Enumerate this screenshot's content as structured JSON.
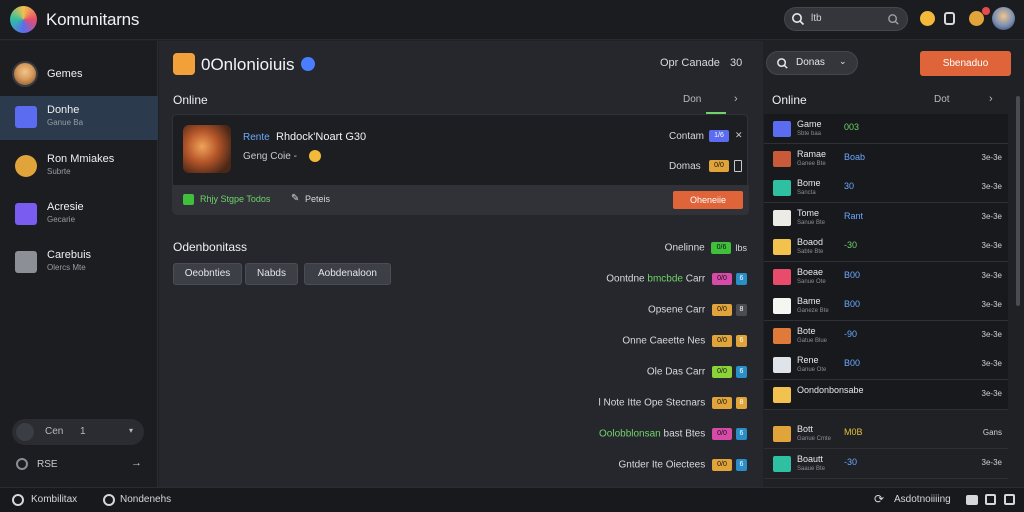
{
  "app": {
    "title": "Komunitarns",
    "search_value": "ltb"
  },
  "sidebar": {
    "profile": {
      "label": "Gemes"
    },
    "items": [
      {
        "label": "Donhe",
        "sub": "Ganue Ba",
        "color": "#5b6cf0",
        "icon": "check-icon"
      },
      {
        "label": "Ron Mmiakes",
        "sub": "Subrte",
        "color": "#e0a43a",
        "icon": "gear-icon"
      },
      {
        "label": "Acresie",
        "sub": "Gecarie",
        "color": "#7a5cf0",
        "icon": "folder-icon"
      },
      {
        "label": "Carebuis",
        "sub": "Olercs Mte",
        "color": "#8d8f96",
        "icon": "store-icon"
      }
    ],
    "status_pill": {
      "label": "Cen",
      "value": "1"
    },
    "footer": {
      "label": "RSE"
    }
  },
  "main": {
    "title": "0Onlonioiuis",
    "sort_label": "Opr Canade",
    "sort_value": "30",
    "dropdown_label": "Donas",
    "primary_button": "Sbenaduo",
    "online": {
      "label": "Online",
      "more": "Don"
    },
    "card": {
      "name_prefix": "Rente",
      "name": "Rhdock'Noart G30",
      "status": "Geng Coie -",
      "row1_label": "Contam",
      "row1_badge": "1/6",
      "row2_label": "Domas",
      "row2_badge": "0/0",
      "footer_left": "Rhjy Stgpe Todos",
      "footer_edit": "Peteis",
      "footer_button": "Oheneiie"
    },
    "section2": {
      "label": "Odenbonitass"
    },
    "buttons": [
      "Oeobnties",
      "Nabds",
      "Aobdenaloon"
    ],
    "list": [
      {
        "label": "Onelinne",
        "hl": "",
        "badge": "0/6",
        "extra": "lbs",
        "color": "#3fbf3a",
        "sq": ""
      },
      {
        "label": "Oontdne ",
        "hl": "bmcbde",
        "label2": " Carr",
        "badge": "0/0",
        "color": "#d64aa8",
        "sq": "6",
        "sqcolor": "#2a8fc8"
      },
      {
        "label": "Opsene Carr",
        "hl": "",
        "badge": "0/0",
        "color": "#e0a43a",
        "sq": "8",
        "sqcolor": "#4a4c53"
      },
      {
        "label": "Onne Caeette Nes",
        "hl": "",
        "badge": "0/0",
        "color": "#e0a43a",
        "sq": "6",
        "sqcolor": "#e0a43a"
      },
      {
        "label": "Ole Das Carr",
        "hl": "",
        "badge": "0/0",
        "color": "#8bd13a",
        "sq": "6",
        "sqcolor": "#2a8fc8"
      },
      {
        "label": "l Note Itte  Ope Stecnars",
        "hl": "",
        "badge": "0/0",
        "color": "#e0a43a",
        "sq": "8",
        "sqcolor": "#e0a43a"
      },
      {
        "label": "",
        "hl": "Oolobblonsan ",
        "label2": "bast Btes",
        "badge": "0/0",
        "color": "#d64aa8",
        "sq": "6",
        "sqcolor": "#2a8fc8"
      },
      {
        "label": "Gntder Ite Oiectees",
        "hl": "",
        "badge": "0/0",
        "color": "#e0a43a",
        "sq": "6",
        "sqcolor": "#2a8fc8"
      }
    ]
  },
  "right": {
    "title": "Online",
    "more": "Dot",
    "rows": [
      {
        "name": "Game",
        "sub": "Sbte baa",
        "val": "003",
        "right": "",
        "thumb": "#5b6cf0",
        "valcolor": "#6fd36a"
      },
      {
        "name": "Ramae",
        "sub": "Ganee Bte",
        "val": "Boab",
        "right": "3e-3e",
        "thumb": "#c85a3a",
        "valcolor": "#6ba8ff"
      },
      {
        "name": "Bome",
        "sub": "Sancta",
        "val": "30",
        "right": "3e-3e",
        "thumb": "#2fbfa1",
        "valcolor": "#6ba8ff"
      },
      {
        "name": "Tome",
        "sub": "Sanue Bte",
        "val": "Rant",
        "right": "3e-3e",
        "thumb": "#ecebe6",
        "valcolor": "#6ba8ff"
      },
      {
        "name": "Boaod",
        "sub": "Sabte Bte",
        "val": "-30",
        "right": "3e-3e",
        "thumb": "#f2c14e",
        "valcolor": "#6fd36a"
      },
      {
        "name": "Boeae",
        "sub": "Sanue Ote",
        "val": "B00",
        "right": "3e-3e",
        "thumb": "#e94b6a",
        "valcolor": "#6ba8ff"
      },
      {
        "name": "Bame",
        "sub": "Ganeze Bte",
        "val": "B00",
        "right": "3e-3e",
        "thumb": "#f5f5f2",
        "valcolor": "#6ba8ff"
      },
      {
        "name": "Bote",
        "sub": "Gatue Blue",
        "val": "-90",
        "right": "3e-3e",
        "thumb": "#e07a3a",
        "valcolor": "#6ba8ff"
      },
      {
        "name": "Rene",
        "sub": "Ganue Ote",
        "val": "B00",
        "right": "3e-3e",
        "thumb": "#dfe3ea",
        "valcolor": "#6ba8ff"
      },
      {
        "name": "Oondonbonsabe",
        "sub": "",
        "val": "",
        "right": "3e-3e",
        "thumb": "#f2c14e",
        "valcolor": "#6ba8ff"
      }
    ],
    "extra": [
      {
        "name": "Bott",
        "sub": "Ganue Cmte",
        "val": "M0B",
        "right": "Gans",
        "thumb": "#e0a43a",
        "valcolor": "#e0c23a"
      },
      {
        "name": "Boautt",
        "sub": "Saaue Bte",
        "val": "-30",
        "right": "3e-3e",
        "thumb": "#2fbfa1",
        "valcolor": "#6ba8ff"
      }
    ]
  },
  "bottom": {
    "left1": "Kombilitax",
    "left2": "Nondenehs",
    "right": "Asdotnoiiiing"
  }
}
